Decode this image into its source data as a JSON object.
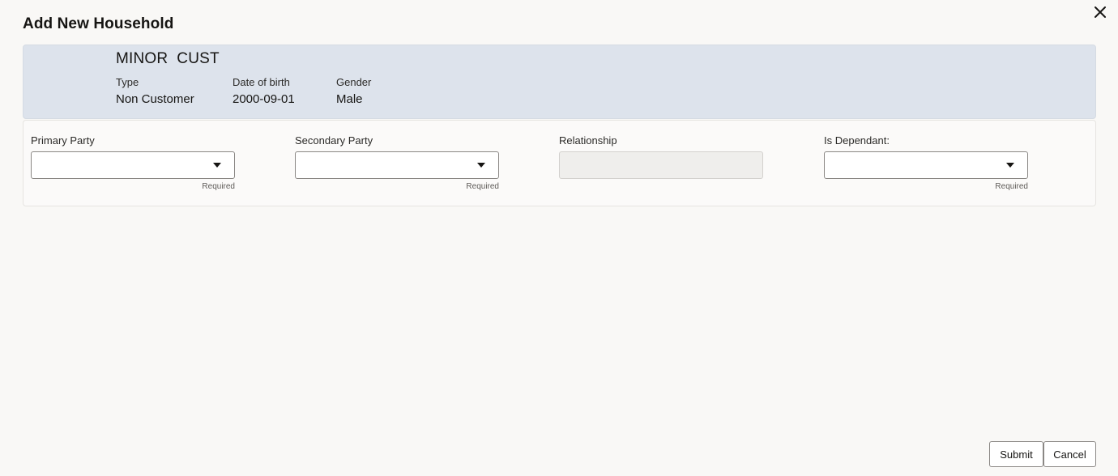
{
  "dialog": {
    "title": "Add New Household",
    "close_icon": "close-icon"
  },
  "customer": {
    "name": "MINOR  CUST",
    "type_label": "Type",
    "type_value": "Non Customer",
    "dob_label": "Date of birth",
    "dob_value": "2000-09-01",
    "gender_label": "Gender",
    "gender_value": "Male"
  },
  "form": {
    "primary_party": {
      "label": "Primary Party",
      "value": "",
      "hint": "Required",
      "icon": "caret-down-icon"
    },
    "secondary_party": {
      "label": "Secondary Party",
      "value": "",
      "hint": "Required",
      "icon": "caret-down-icon"
    },
    "relationship": {
      "label": "Relationship",
      "value": "",
      "disabled": true
    },
    "is_dependant": {
      "label": "Is Dependant:",
      "value": "",
      "hint": "Required",
      "icon": "caret-down-icon"
    }
  },
  "footer": {
    "submit_label": "Submit",
    "cancel_label": "Cancel"
  }
}
